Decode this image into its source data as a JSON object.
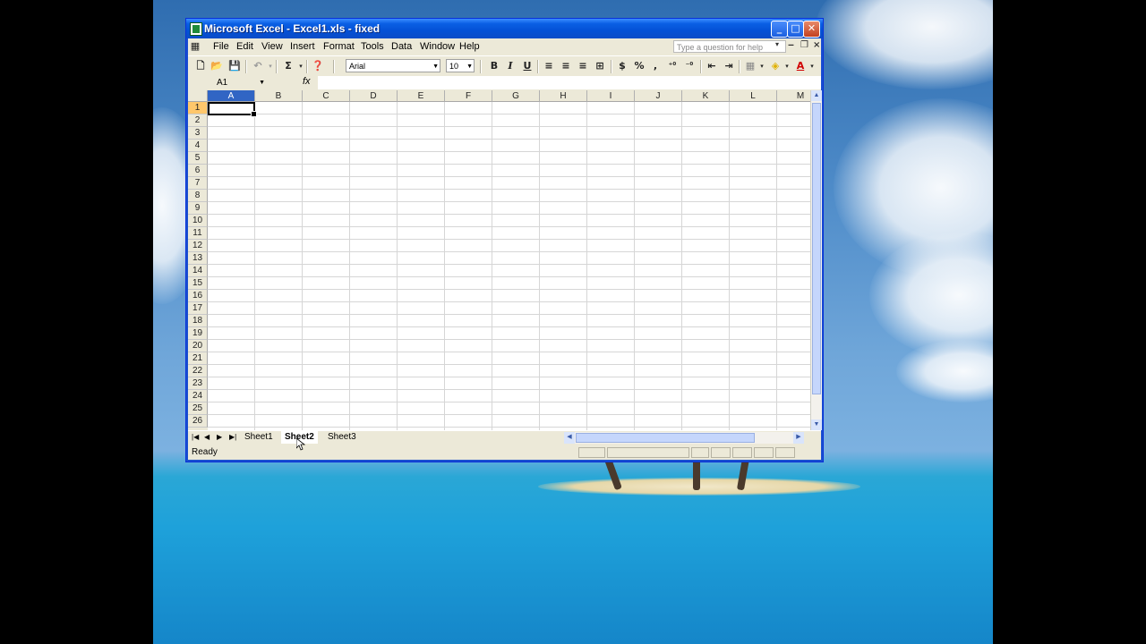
{
  "window": {
    "title": "Microsoft Excel - Excel1.xls - fixed"
  },
  "menu": [
    "File",
    "Edit",
    "View",
    "Insert",
    "Format",
    "Tools",
    "Data",
    "Window",
    "Help"
  ],
  "help_search": {
    "placeholder": "Type a question for help"
  },
  "toolbar": {
    "font_name": "Arial",
    "font_size": "10",
    "bold": "B",
    "italic": "I",
    "underline": "U",
    "currency": "$",
    "percent": "%",
    "comma": ",",
    "autosum": "Σ"
  },
  "formula_bar": {
    "name_box": "A1",
    "fx": "fx",
    "value": ""
  },
  "grid": {
    "columns": [
      "A",
      "B",
      "C",
      "D",
      "E",
      "F",
      "G",
      "H",
      "I",
      "J",
      "K",
      "L",
      "M"
    ],
    "rows": [
      "1",
      "2",
      "3",
      "4",
      "5",
      "6",
      "7",
      "8",
      "9",
      "10",
      "11",
      "12",
      "13",
      "14",
      "15",
      "16",
      "17",
      "18",
      "19",
      "20",
      "21",
      "22",
      "23",
      "24",
      "25",
      "26"
    ],
    "active_cell": "A1"
  },
  "sheets": [
    {
      "name": "Sheet1",
      "active": false
    },
    {
      "name": "Sheet2",
      "active": true
    },
    {
      "name": "Sheet3",
      "active": false
    }
  ],
  "status": {
    "text": "Ready"
  },
  "colors": {
    "titlebar": "#0a5fe4",
    "selection_header": "#3165c4",
    "row_highlight": "#ffc76b"
  }
}
